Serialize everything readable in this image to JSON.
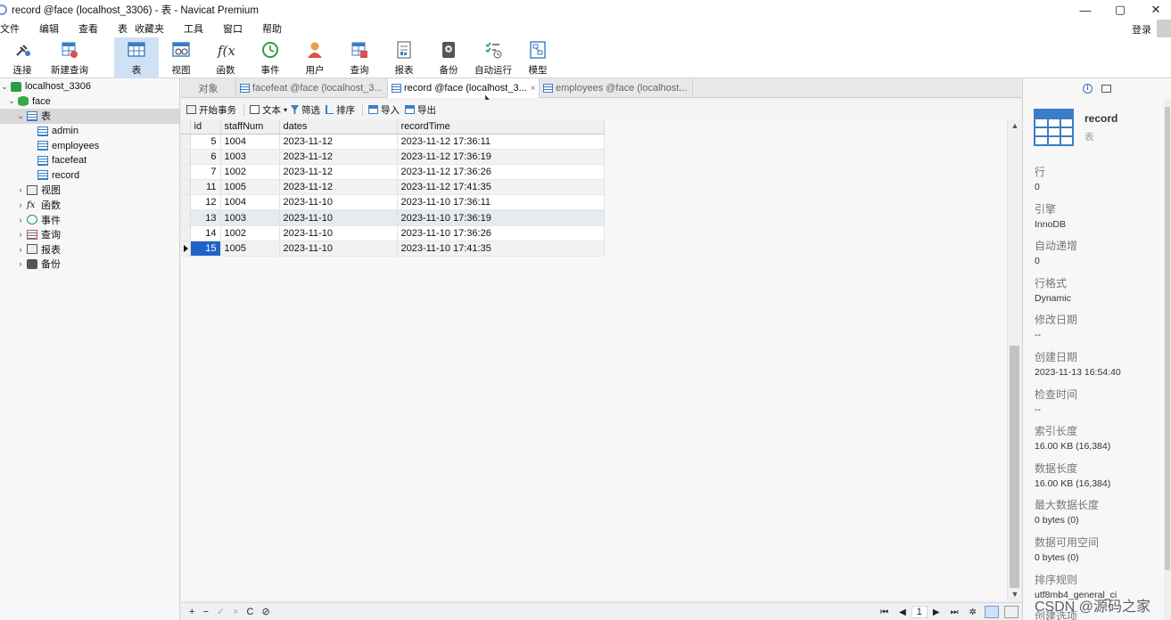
{
  "window": {
    "title": "record @face (localhost_3306) - 表 - Navicat Premium",
    "controls": {
      "minimize": "—",
      "maximize": "▢",
      "close": "✕"
    }
  },
  "menubar": {
    "items": [
      "文件",
      "编辑",
      "查看",
      "表",
      "收藏夹",
      "工具",
      "窗口",
      "帮助"
    ],
    "login": "登录"
  },
  "toolbar": {
    "items": [
      {
        "label": "连接",
        "icon": "plug-icon"
      },
      {
        "label": "新建查询",
        "icon": "new-query-icon"
      },
      {
        "label": "表",
        "icon": "table-icon",
        "active": true
      },
      {
        "label": "视图",
        "icon": "view-icon"
      },
      {
        "label": "函数",
        "icon": "function-icon"
      },
      {
        "label": "事件",
        "icon": "clock-icon"
      },
      {
        "label": "用户",
        "icon": "user-icon"
      },
      {
        "label": "查询",
        "icon": "query-icon"
      },
      {
        "label": "报表",
        "icon": "report-icon"
      },
      {
        "label": "备份",
        "icon": "backup-icon"
      },
      {
        "label": "自动运行",
        "icon": "autorun-icon"
      },
      {
        "label": "模型",
        "icon": "model-icon"
      }
    ]
  },
  "tree": {
    "connection": "localhost_3306",
    "database": "face",
    "tables_group": "表",
    "tables": [
      "admin",
      "employees",
      "facefeat",
      "record"
    ],
    "groups": [
      {
        "label": "视图",
        "icon": "view-icon"
      },
      {
        "label": "函数",
        "icon": "function-icon"
      },
      {
        "label": "事件",
        "icon": "clock-icon"
      },
      {
        "label": "查询",
        "icon": "query-icon"
      },
      {
        "label": "报表",
        "icon": "report-icon"
      },
      {
        "label": "备份",
        "icon": "backup-icon"
      }
    ]
  },
  "tabs": {
    "objects": "对象",
    "items": [
      {
        "label": "facefeat @face (localhost_3...",
        "active": false,
        "close": ""
      },
      {
        "label": "record @face (localhost_3...",
        "active": true,
        "close": "×"
      },
      {
        "label": "employees @face (localhost...",
        "active": false,
        "close": ""
      }
    ]
  },
  "gridbar": {
    "begin_transaction": "开始事务",
    "text": "文本",
    "filter": "筛选",
    "sort": "排序",
    "import": "导入",
    "export": "导出"
  },
  "grid": {
    "columns": [
      "id",
      "staffNum",
      "dates",
      "recordTime"
    ],
    "rows": [
      [
        "5",
        "1004",
        "2023-11-12",
        "2023-11-12 17:36:11"
      ],
      [
        "6",
        "1003",
        "2023-11-12",
        "2023-11-12 17:36:19"
      ],
      [
        "7",
        "1002",
        "2023-11-12",
        "2023-11-12 17:36:26"
      ],
      [
        "11",
        "1005",
        "2023-11-12",
        "2023-11-12 17:41:35"
      ],
      [
        "12",
        "1004",
        "2023-11-10",
        "2023-11-10 17:36:11"
      ],
      [
        "13",
        "1003",
        "2023-11-10",
        "2023-11-10 17:36:19"
      ],
      [
        "14",
        "1002",
        "2023-11-10",
        "2023-11-10 17:36:26"
      ],
      [
        "15",
        "1005",
        "2023-11-10",
        "2023-11-10 17:41:35"
      ]
    ],
    "current_row": 7
  },
  "bottombar": {
    "add": "+",
    "remove": "−",
    "apply": "✓",
    "cancel": "×",
    "refresh": "C",
    "stop": "⊘",
    "first": "⏮",
    "prev": "◀",
    "page": "1",
    "next": "▶",
    "last": "⏭",
    "settings": "✲"
  },
  "info": {
    "name": "record",
    "kind": "表",
    "props": [
      {
        "k": "行",
        "v": "0"
      },
      {
        "k": "引擎",
        "v": "InnoDB"
      },
      {
        "k": "自动递增",
        "v": "0"
      },
      {
        "k": "行格式",
        "v": "Dynamic"
      },
      {
        "k": "修改日期",
        "v": "--"
      },
      {
        "k": "创建日期",
        "v": "2023-11-13 16:54:40"
      },
      {
        "k": "检查时间",
        "v": "--"
      },
      {
        "k": "索引长度",
        "v": "16.00 KB (16,384)"
      },
      {
        "k": "数据长度",
        "v": "16.00 KB (16,384)"
      },
      {
        "k": "最大数据长度",
        "v": "0 bytes (0)"
      },
      {
        "k": "数据可用空间",
        "v": "0 bytes (0)"
      },
      {
        "k": "排序规则",
        "v": "utf8mb4_general_ci"
      },
      {
        "k": "创建选项",
        "v": ""
      }
    ]
  },
  "watermark": "CSDN @源码之家",
  "colors": {
    "accent": "#1e63c8",
    "active_tool": "#cfe2f5",
    "table_icon": "#3b7dc4"
  }
}
